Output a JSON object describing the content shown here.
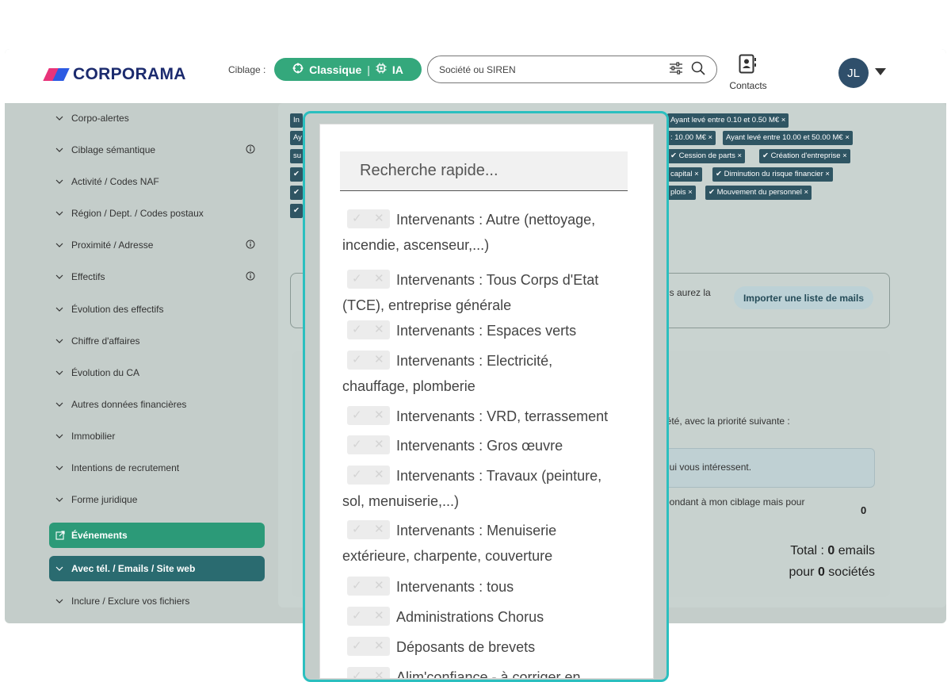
{
  "header": {
    "logo_text": "CORPORAMA",
    "ciblage_label": "Ciblage :",
    "mode_classique": "Classique",
    "mode_separator": "|",
    "mode_ia": "IA",
    "search_placeholder": "Société ou SIREN",
    "contacts_label": "Contacts",
    "avatar_initials": "JL"
  },
  "sidebar": {
    "items": [
      {
        "label": "Corpo-alertes"
      },
      {
        "label": "Ciblage sémantique",
        "info": true
      },
      {
        "label": "Activité / Codes NAF"
      },
      {
        "label": "Région / Dept. / Codes postaux"
      },
      {
        "label": "Proximité / Adresse",
        "info": true
      },
      {
        "label": "Effectifs",
        "info": true
      },
      {
        "label": "Évolution des effectifs"
      },
      {
        "label": "Chiffre d'affaires"
      },
      {
        "label": "Évolution du CA"
      },
      {
        "label": "Autres données financières"
      },
      {
        "label": "Immobilier"
      },
      {
        "label": "Intentions de recrutement"
      },
      {
        "label": "Forme juridique"
      },
      {
        "label": "Événements"
      },
      {
        "label": "Avec tél. / Emails / Site web"
      },
      {
        "label": "Inclure / Exclure vos fichiers"
      }
    ]
  },
  "tags": {
    "t0": "In",
    "t1": "Ayant levé entre 0.10 et 0.50 M€ ×",
    "t2": "Ay",
    "t3": ": 10.00 M€ ×",
    "t4": "Ayant levé entre 10.00 et 50.00 M€ ×",
    "t5": "su",
    "t6": "✔ Cession de parts ×",
    "t7": "✔ Création d'entreprise ×",
    "t8": "✔",
    "t9": "capital ×",
    "t10": "✔ Diminution du risque financier ×",
    "t11": "✔",
    "t12": "plois ×",
    "t13": "✔ Mouvement du personnel ×",
    "t14": "✔"
  },
  "main": {
    "import_text": "us aurez la",
    "import_button": "Importer une liste de mails",
    "priority_text": "iété, avec la priorité suivante :",
    "interest_text": "qui vous intéressent.",
    "ciblage_text": "pondant à mon ciblage mais pour",
    "zero_value": "0",
    "total_prefix": "Total : ",
    "total_emails_count": "0",
    "total_emails_suffix": " emails",
    "total_companies_prefix": "pour ",
    "total_companies_count": "0",
    "total_companies_suffix": " sociétés"
  },
  "dropdown": {
    "search_placeholder": "Recherche rapide...",
    "options": [
      {
        "line1": "Intervenants : Autre (nettoyage,",
        "line2": "incendie, ascenseur,...)"
      },
      {
        "line1": "Intervenants : Tous Corps d'Etat",
        "line2": "(TCE), entreprise générale"
      },
      {
        "line1": "Intervenants : Espaces verts"
      },
      {
        "line1": "Intervenants : Electricité,",
        "line2": "chauffage, plomberie"
      },
      {
        "line1": "Intervenants : VRD, terrassement"
      },
      {
        "line1": "Intervenants : Gros œuvre"
      },
      {
        "line1": "Intervenants : Travaux (peinture,",
        "line2": "sol, menuiserie,...)"
      },
      {
        "line1": "Intervenants : Menuiserie",
        "line2": "extérieure, charpente, couverture"
      },
      {
        "line1": "Intervenants : tous"
      },
      {
        "line1": "Administrations Chorus"
      },
      {
        "line1": "Déposants de brevets"
      },
      {
        "line1": "Alim'confiance - à corriger en"
      }
    ]
  },
  "colors": {
    "accent_green": "#34a87c",
    "sidebar_bg": "#c4cdca",
    "tag_bg": "#2f5563",
    "overlay_border": "#2bbfbf"
  }
}
